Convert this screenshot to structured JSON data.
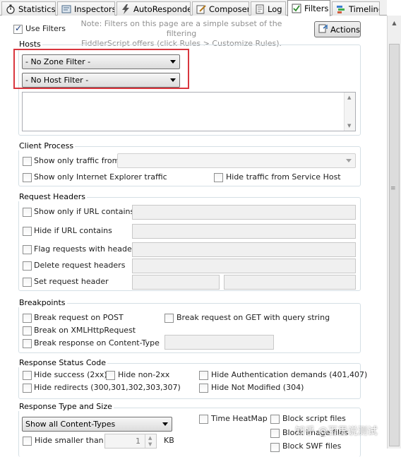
{
  "tabs": [
    {
      "label": "Statistics",
      "icon": "stopwatch-icon"
    },
    {
      "label": "Inspectors",
      "icon": "inspectors-icon"
    },
    {
      "label": "AutoResponder",
      "icon": "lightning-icon"
    },
    {
      "label": "Composer",
      "icon": "composer-icon"
    },
    {
      "label": "Log",
      "icon": "log-icon"
    },
    {
      "label": "Filters",
      "icon": "checkbox-icon"
    },
    {
      "label": "Timeline",
      "icon": "timeline-icon"
    }
  ],
  "use_filters": {
    "label": "Use Filters",
    "checked": true
  },
  "note": {
    "line1": "Note: Filters on this page are a simple subset of the filtering",
    "line2": "FiddlerScript offers (click Rules > Customize Rules)."
  },
  "actions_button": "Actions",
  "hosts": {
    "title": "Hosts",
    "zone_filter": "- No Zone Filter -",
    "host_filter": "- No Host Filter -"
  },
  "client_process": {
    "title": "Client Process",
    "show_traffic_from": "Show only traffic from",
    "show_ie": "Show only Internet Explorer traffic",
    "hide_service_host": "Hide traffic from Service Host"
  },
  "request_headers": {
    "title": "Request Headers",
    "url_contains": "Show only if URL contains",
    "hide_url": "Hide if URL contains",
    "flag_headers": "Flag requests with headers",
    "delete_headers": "Delete request headers",
    "set_header": "Set request header"
  },
  "breakpoints": {
    "title": "Breakpoints",
    "break_post": "Break request on POST",
    "break_get": "Break request on GET with query string",
    "break_xhr": "Break on XMLHttpRequest",
    "break_response": "Break response on Content-Type"
  },
  "status_code": {
    "title": "Response Status Code",
    "hide_success": "Hide success (2xx)",
    "hide_non2xx": "Hide non-2xx",
    "hide_auth": "Hide Authentication demands (401,407)",
    "hide_redirects": "Hide redirects (300,301,302,303,307)",
    "hide_not_modified": "Hide Not Modified (304)"
  },
  "response_type": {
    "title": "Response Type and Size",
    "content_types": "Show all Content-Types",
    "time_heatmap": "Time HeatMap",
    "block_script": "Block script files",
    "block_image": "Block image files",
    "block_swf": "Block SWF files",
    "hide_smaller": "Hide smaller than",
    "size_value": "1",
    "size_unit": "KB"
  },
  "watermark": "知乎 @百里说测试",
  "colors": {
    "highlight_box": "#d9363e",
    "group_border": "#d5dfe5"
  }
}
